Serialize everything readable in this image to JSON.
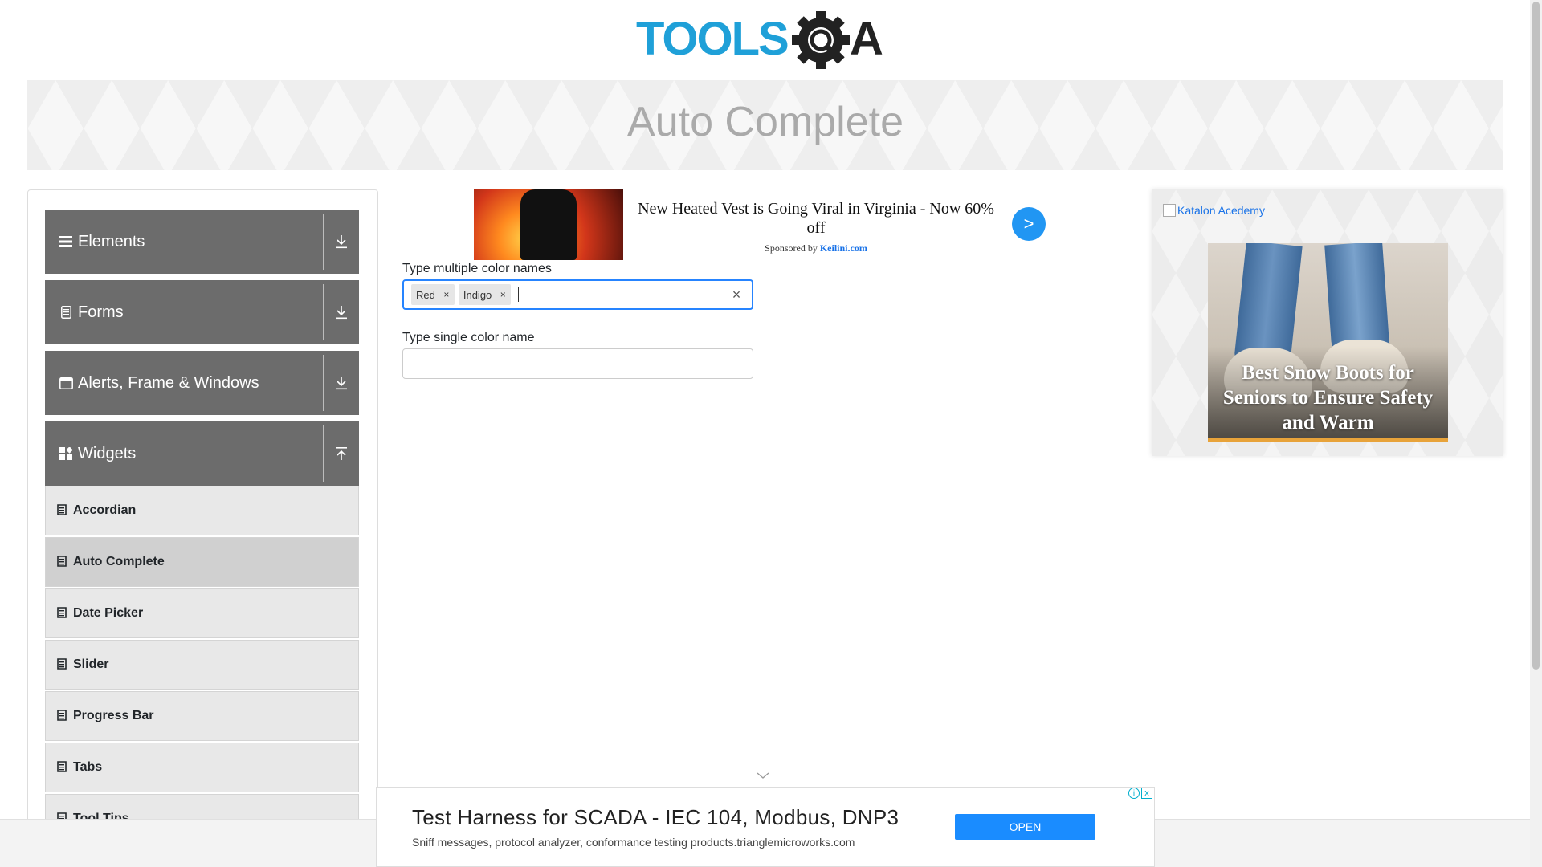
{
  "header": {
    "logo_text": "TOOLSQA",
    "logo_icon": "gear-magnifier-icon"
  },
  "banner": {
    "title": "Auto Complete"
  },
  "sidebar": {
    "groups": [
      {
        "label": "Elements",
        "icon": "hamburger-icon",
        "arrow": "download-icon"
      },
      {
        "label": "Forms",
        "icon": "document-icon",
        "arrow": "download-icon"
      },
      {
        "label": "Alerts, Frame & Windows",
        "icon": "window-icon",
        "arrow": "download-icon"
      },
      {
        "label": "Widgets",
        "icon": "widgets-icon",
        "arrow": "upload-icon"
      }
    ],
    "items": [
      {
        "label": "Accordian"
      },
      {
        "label": "Auto Complete",
        "active": true
      },
      {
        "label": "Date Picker"
      },
      {
        "label": "Slider"
      },
      {
        "label": "Progress Bar"
      },
      {
        "label": "Tabs"
      },
      {
        "label": "Tool Tips"
      }
    ]
  },
  "ad_top": {
    "headline": "New Heated Vest is Going Viral in Virginia - Now 60% off",
    "sponsored_prefix": "Sponsored by",
    "sponsor": "Keilini.com",
    "go_label": ">"
  },
  "form": {
    "multi_label": "Type multiple color names",
    "chips": [
      "Red",
      "Indigo"
    ],
    "chip_remove": "×",
    "clear_label": "×",
    "single_label": "Type single color name",
    "single_value": ""
  },
  "right_ad": {
    "alt_text": "Katalon Acedemy",
    "headline": "Best Snow Boots for Seniors to Ensure Safety and Warm"
  },
  "bottom_ad": {
    "title": "Test Harness for SCADA - IEC 104, Modbus, DNP3",
    "subtitle": "Sniff messages, protocol analyzer, conformance testing products.trianglemicroworks.com",
    "open_label": "OPEN",
    "info_glyph": "i",
    "close_glyph": "x"
  },
  "colors": {
    "accent": "#2684ff",
    "sidebar_group": "#6c6c6c",
    "logo_blue": "#1fa0d8",
    "logo_dark": "#222222"
  }
}
